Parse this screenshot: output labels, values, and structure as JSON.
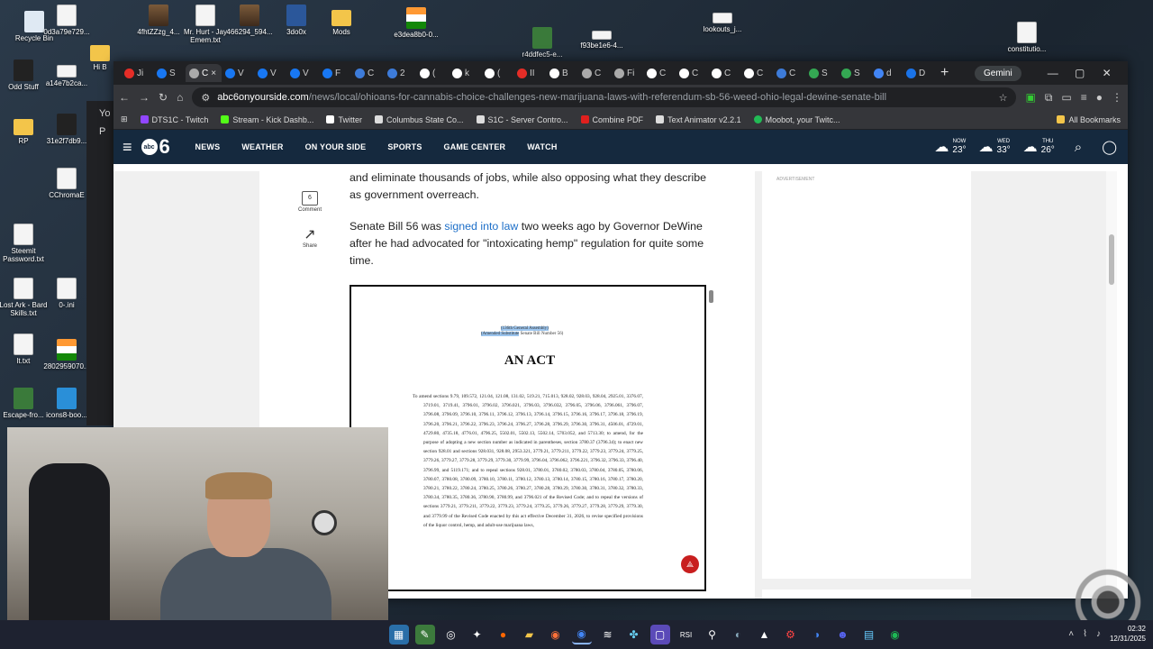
{
  "desktop": {
    "icons": [
      {
        "label": "Recycle Bin",
        "icon": "recycle-bin-icon"
      },
      {
        "label": "0d3a79e729...",
        "icon": "file-icon"
      },
      {
        "label": "4fhtZZzg_4...",
        "icon": "image-icon"
      },
      {
        "label": "Mr. Hurt - Jay Emem.txt",
        "icon": "file-icon"
      },
      {
        "label": "466294_594...",
        "icon": "image-icon"
      },
      {
        "label": "3do0x",
        "icon": "word-icon"
      },
      {
        "label": "Mods",
        "icon": "folder-icon"
      },
      {
        "label": "e3dea8b0-0...",
        "icon": "flag-icon"
      },
      {
        "label": "r4ddfec5-e...",
        "icon": "image-icon"
      },
      {
        "label": "f93be1e6-4...",
        "icon": "file-icon"
      },
      {
        "label": "lookouts_j...",
        "icon": "file-icon"
      },
      {
        "label": "constitutio...",
        "icon": "file-icon"
      },
      {
        "label": "Odd Stuff",
        "icon": "folder-icon"
      },
      {
        "label": "a14e7b2ca...",
        "icon": "file-icon"
      },
      {
        "label": "Hi B",
        "icon": "folder-icon"
      },
      {
        "label": "RP",
        "icon": "folder-icon"
      },
      {
        "label": "31e2f7db9...",
        "icon": "image-icon"
      },
      {
        "label": "CChromaE",
        "icon": "file-icon"
      },
      {
        "label": "Steemit Password.txt",
        "icon": "file-icon"
      },
      {
        "label": "Lost Ark - Bard Skills.txt",
        "icon": "file-icon"
      },
      {
        "label": "0-.ini",
        "icon": "file-icon"
      },
      {
        "label": "lt.txt",
        "icon": "file-icon"
      },
      {
        "label": "2802959070...",
        "icon": "image-icon"
      },
      {
        "label": "Escape-fro...",
        "icon": "image-icon"
      },
      {
        "label": "icons8-boo...",
        "icon": "file-icon"
      }
    ],
    "behind_window_labels": [
      "Yo",
      "P"
    ]
  },
  "browser": {
    "tabs": [
      {
        "label": "Ji",
        "favicon_color": "#e52d27"
      },
      {
        "label": "S",
        "favicon_color": "#1877f2"
      },
      {
        "label": "C",
        "favicon_color": "#aaaaaa",
        "active": true
      },
      {
        "label": "V",
        "favicon_color": "#1877f2"
      },
      {
        "label": "V",
        "favicon_color": "#1877f2"
      },
      {
        "label": "V",
        "favicon_color": "#1877f2"
      },
      {
        "label": "F",
        "favicon_color": "#1877f2"
      },
      {
        "label": "C",
        "favicon_color": "#3d7bd9"
      },
      {
        "label": "2",
        "favicon_color": "#3d7bd9"
      },
      {
        "label": "(",
        "favicon_color": "#ffffff"
      },
      {
        "label": "k",
        "favicon_color": "#ffffff"
      },
      {
        "label": "(",
        "favicon_color": "#ffffff"
      },
      {
        "label": "II",
        "favicon_color": "#e52d27"
      },
      {
        "label": "B",
        "favicon_color": "#ffffff"
      },
      {
        "label": "C",
        "favicon_color": "#aaaaaa"
      },
      {
        "label": "Fi",
        "favicon_color": "#aaaaaa"
      },
      {
        "label": "C",
        "favicon_color": "#ffffff"
      },
      {
        "label": "C",
        "favicon_color": "#ffffff"
      },
      {
        "label": "C",
        "favicon_color": "#ffffff"
      },
      {
        "label": "C",
        "favicon_color": "#ffffff"
      },
      {
        "label": "C",
        "favicon_color": "#3d7bd9"
      },
      {
        "label": "S",
        "favicon_color": "#34a853"
      },
      {
        "label": "S",
        "favicon_color": "#34a853"
      },
      {
        "label": "d",
        "favicon_color": "#4285f4"
      },
      {
        "label": "D",
        "favicon_color": "#1a73e8"
      }
    ],
    "gemini_label": "Gemini",
    "url_domain": "abc6onyourside.com",
    "url_path": "/news/local/ohioans-for-cannabis-choice-challenges-new-marijuana-laws-with-referendum-sb-56-weed-ohio-legal-dewine-senate-bill",
    "bookmarks": [
      {
        "label": "DTS1C - Twitch",
        "color": "#9146ff"
      },
      {
        "label": "Stream - Kick Dashb...",
        "color": "#53fc18"
      },
      {
        "label": "Twitter",
        "color": "#ffffff"
      },
      {
        "label": "Columbus State Co...",
        "color": "#dddddd"
      },
      {
        "label": "S1C - Server Contro...",
        "color": "#dddddd"
      },
      {
        "label": "Combine PDF",
        "color": "#e0201e"
      },
      {
        "label": "Text Animator v2.2.1",
        "color": "#dddddd"
      },
      {
        "label": "Moobot, your Twitc...",
        "color": "#22bb55"
      }
    ],
    "all_bookmarks_label": "All Bookmarks"
  },
  "site": {
    "logo_abc": "abc",
    "logo_six": "6",
    "nav": [
      "NEWS",
      "WEATHER",
      "ON YOUR SIDE",
      "SPORTS",
      "GAME CENTER",
      "WATCH"
    ],
    "weather": [
      {
        "label": "NOW",
        "temp": "23°"
      },
      {
        "label": "WED",
        "temp": "33°"
      },
      {
        "label": "THU",
        "temp": "26°"
      }
    ],
    "ad_label": "ADVERTISEMENT"
  },
  "article": {
    "comment_count": "6",
    "comment_label": "Comment",
    "share_label": "Share",
    "para1": "and eliminate thousands of jobs, while also opposing what they describe as government overreach.",
    "para2_pre": "Senate Bill 56 was ",
    "para2_link": "signed into law",
    "para2_post": " two weeks ago by Governor DeWine after he had advocated for \"intoxicating hemp\" regulation for quite some time."
  },
  "pdf": {
    "header_line1": "(136th General Assembly)",
    "header_line2_hl": "(Amended Substitute",
    "header_line2_rest": " Senate Bill Number 56)",
    "title": "AN ACT",
    "body": "To amend sections 9.79, 109.572, 121.04, 121.08, 131.02, 519.21, 715.013, 928.02, 928.03, 928.04, 2925.01, 3376.07, 3719.01, 3719.41, 3796.01, 3796.02, 3796.021, 3796.03, 3796.032, 3796.05, 3796.06, 3796.061, 3796.07, 3796.08, 3796.09, 3796.10, 3796.11, 3796.12, 3796.13, 3796.14, 3796.15, 3796.16, 3796.17, 3796.18, 3796.19, 3796.20, 3796.21, 3796.22, 3796.23, 3796.24, 3796.27, 3796.28, 3796.29, 3796.30, 3796.31, 4506.01, 4729.01, 4729.80, 4735.18, 4776.01, 4796.25, 5502.01, 5502.13, 5502.14, 5703.052, and 5713.30; to amend, for the purpose of adopting a new section number as indicated in parentheses, section 3780.37 (3796.34); to enact new section 928.01 and sections 928.031, 928.08, 2953.321, 3779.21, 3779.211, 3779.22, 3779.23, 3779.24, 3779.25, 3779.26, 3779.27, 3779.28, 3779.29, 3779.30, 3779.99, 3796.04, 3796.062, 3796.221, 3796.32, 3796.33, 3796.40, 3796.99, and 5119.171; and to repeal sections 928.01, 3780.01, 3780.02, 3780.03, 3780.04, 3780.05, 3780.06, 3780.07, 3780.08, 3780.09, 3780.10, 3780.11, 3780.12, 3780.13, 3780.14, 3780.15, 3780.16, 3780.17, 3780.20, 3780.21, 3780.22, 3780.24, 3780.25, 3780.26, 3780.27, 3780.28, 3780.29, 3780.30, 3780.31, 3780.32, 3780.33, 3780.34, 3780.35, 3780.36, 3780.90, 3780.99, and 3796.021 of the Revised Code; and to repeal the versions of sections 3779.21, 3779.211, 3779.22, 3779.23, 3779.24, 3779.25, 3779.26, 3779.27, 3779.28, 3779.29, 3779.30, and 3779.99 of the Revised Code enacted by this act effective December 31, 2026, to revise specified provisions of the liquor control, hemp, and adult-use marijuana laws,"
  },
  "taskbar": {
    "time": "02:32",
    "date": "12/31/2025"
  }
}
